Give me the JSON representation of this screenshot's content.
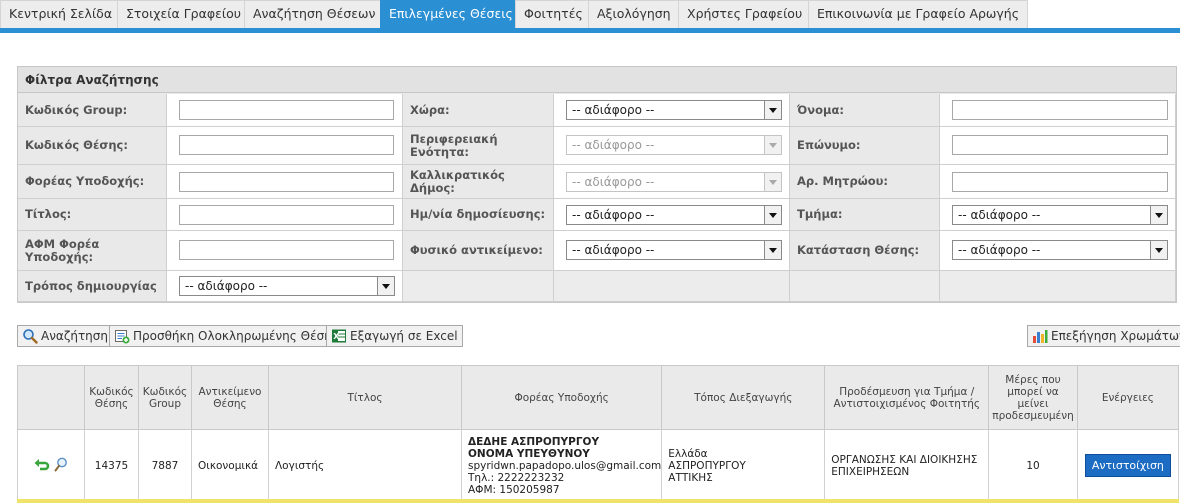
{
  "nav": {
    "tabs": [
      {
        "label": "Κεντρική Σελίδα",
        "active": false
      },
      {
        "label": "Στοιχεία Γραφείου",
        "active": false
      },
      {
        "label": "Αναζήτηση Θέσεων",
        "active": false
      },
      {
        "label": "Επιλεγμένες Θέσεις",
        "active": true
      },
      {
        "label": "Φοιτητές",
        "active": false
      },
      {
        "label": "Αξιολόγηση",
        "active": false
      },
      {
        "label": "Χρήστες Γραφείου",
        "active": false
      },
      {
        "label": "Επικοινωνία με Γραφείο Αρωγής",
        "active": false
      }
    ],
    "accent_color": "#2a8fd3"
  },
  "filters": {
    "title": "Φίλτρα Αναζήτησης",
    "group_code": {
      "label": "Κωδικός Group:",
      "value": ""
    },
    "position_code": {
      "label": "Κωδικός Θέσης:",
      "value": ""
    },
    "host": {
      "label": "Φορέας Υποδοχής:",
      "value": ""
    },
    "title_field": {
      "label": "Τίτλος:",
      "value": ""
    },
    "host_afm": {
      "label": "ΑΦΜ Φορέα Υποδοχής:",
      "value": ""
    },
    "creation_mode": {
      "label": "Τρόπος δημιουργίας",
      "value": "-- αδιάφορο --"
    },
    "country": {
      "label": "Χώρα:",
      "value": "-- αδιάφορο --"
    },
    "region": {
      "label": "Περιφερειακή Ενότητα:",
      "value": "-- αδιάφορο --"
    },
    "municipality": {
      "label": "Καλλικρατικός Δήμος:",
      "value": "-- αδιάφορο --"
    },
    "pub_date": {
      "label": "Ημ/νία δημοσίευσης:",
      "value": "-- αδιάφορο --"
    },
    "physical_object": {
      "label": "Φυσικό αντικείμενο:",
      "value": "-- αδιάφορο --"
    },
    "first_name": {
      "label": "Όνομα:",
      "value": ""
    },
    "last_name": {
      "label": "Επώνυμο:",
      "value": ""
    },
    "reg_number": {
      "label": "Αρ. Μητρώου:",
      "value": ""
    },
    "department": {
      "label": "Τμήμα:",
      "value": "-- αδιάφορο --"
    },
    "position_status": {
      "label": "Κατάσταση Θέσης:",
      "value": "-- αδιάφορο --"
    }
  },
  "actions": {
    "search": "Αναζήτηση",
    "add_completed": "Προσθήκη Ολοκληρωμένης Θέσης",
    "export_excel": "Εξαγωγή σε Excel",
    "color_legend": "Επεξήγηση Χρωμάτων"
  },
  "table": {
    "headers": {
      "position_code": "Κωδικός Θέσης",
      "group_code": "Κωδικός Group",
      "subject": "Αντικείμενο Θέσης",
      "title": "Τίτλος",
      "host": "Φορέας Υποδοχής",
      "location": "Τόπος Διεξαγωγής",
      "reserved_for": "Προδέσμευση για Τμήμα / Αντιστοιχισμένος Φοιτητής",
      "days_left": "Μέρες που μπορεί να μείνει προδεσμευμένη",
      "actions": "Ενέργειες"
    },
    "rows": [
      {
        "position_code": "14375",
        "group_code": "7887",
        "subject": "Οικονομικά",
        "title": "Λογιστής",
        "host_name": "ΔΕΔΗΕ ΑΣΠΡΟΠΥΡΓΟΥ",
        "contact_name": "ΟΝΟΜΑ ΥΠΕΥΘΥΝΟΥ",
        "email": "spyridwn.papadopo.ulos@gmail.com",
        "phone": "Τηλ.: 2222223232",
        "afm": "ΑΦΜ: 150205987",
        "loc_country": "Ελλάδα",
        "loc_city": "ΑΣΠΡΟΠΥΡΓΟΥ",
        "loc_region": "ΑΤΤΙΚΗΣ",
        "reserved_for": "ΟΡΓΑΝΩΣΗΣ ΚΑΙ ΔΙΟΙΚΗΣΗΣ ΕΠΙΧΕΙΡΗΣΕΩΝ",
        "days_left": "10",
        "assign_label": "Αντιστοίχιση"
      }
    ]
  }
}
